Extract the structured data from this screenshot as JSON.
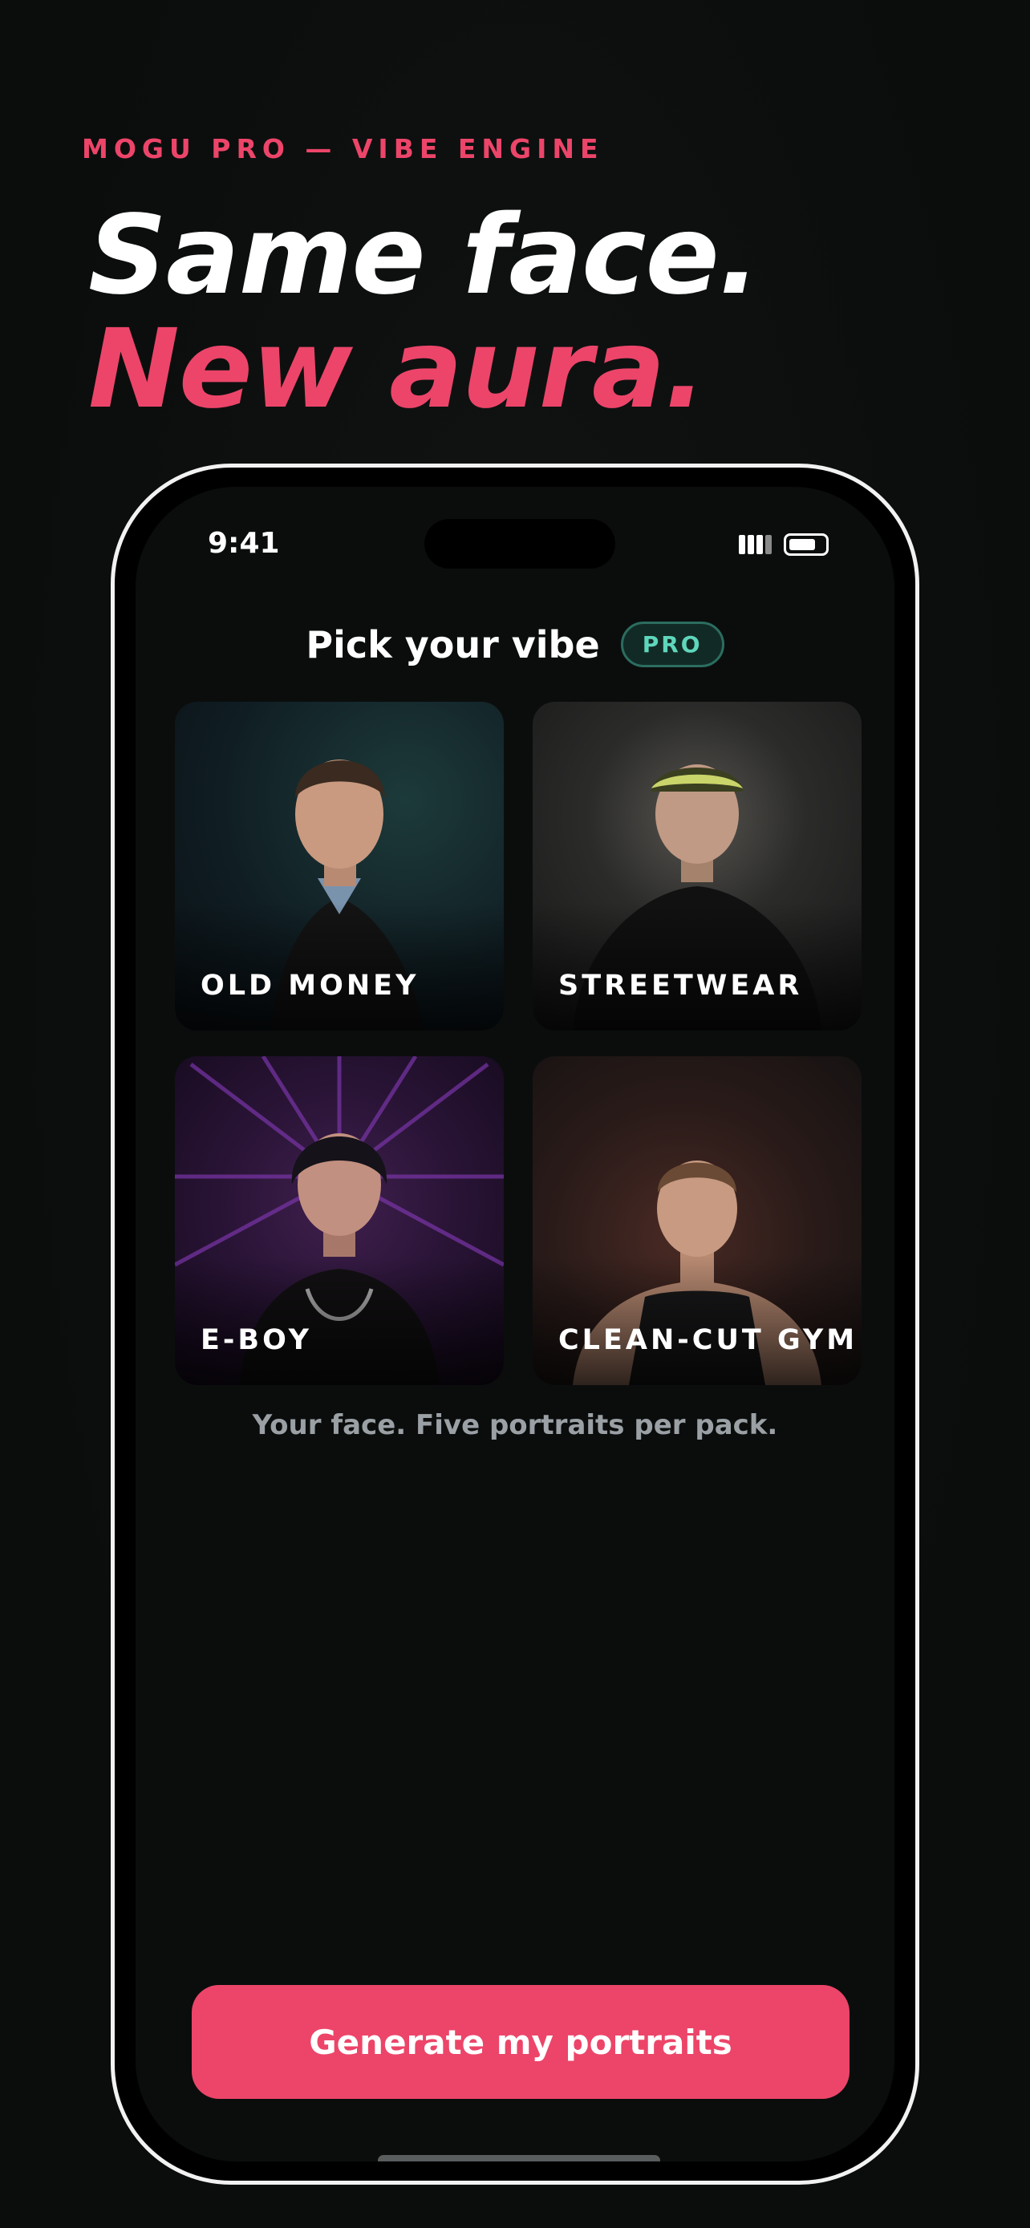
{
  "header": {
    "eyebrow": "MOGU PRO — VIBE ENGINE",
    "headline_line1": "Same face.",
    "headline_line2": "New aura."
  },
  "status_bar": {
    "time": "9:41",
    "signal_icon": "cellular-signal-icon",
    "battery_icon": "battery-icon"
  },
  "screen": {
    "title": "Pick your vibe",
    "badge": "PRO",
    "vibes": [
      {
        "label": "OLD MONEY",
        "image": "portrait-old-money"
      },
      {
        "label": "STREETWEAR",
        "image": "portrait-streetwear"
      },
      {
        "label": "E-BOY",
        "image": "portrait-e-boy"
      },
      {
        "label": "CLEAN-CUT GYM",
        "image": "portrait-clean-cut-gym"
      }
    ],
    "caption": "Your face. Five portraits per pack.",
    "cta_label": "Generate my portraits"
  },
  "colors": {
    "accent": "#ec4569",
    "background": "#0d0f0f",
    "badge_text": "#5fd6bc",
    "caption_text": "#9aa0a4"
  }
}
